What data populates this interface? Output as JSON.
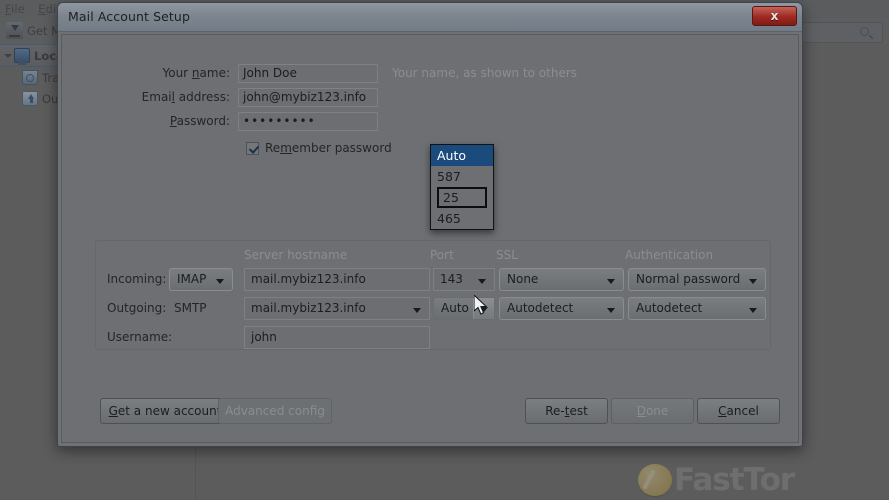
{
  "background": {
    "menubar": [
      {
        "pre": "",
        "accel": "F",
        "post": "ile"
      },
      {
        "pre": "",
        "accel": "E",
        "post": "dit"
      }
    ],
    "toolbar": {
      "get_mail_label": "Get M",
      "get_mail_icon": "download-icon"
    },
    "search": {
      "value": "",
      "icon": "search-icon"
    },
    "folders": [
      {
        "label": "Loca",
        "icon": "monitor-icon",
        "level": 1,
        "account": true
      },
      {
        "label": "Tra",
        "icon": "trash-icon",
        "level": 2,
        "account": false
      },
      {
        "label": "Ou",
        "icon": "outbox-icon",
        "level": 2,
        "account": false
      }
    ]
  },
  "watermark": {
    "text": "FastTor",
    "logo": "coin-logo"
  },
  "dialog": {
    "title": "Mail Account Setup",
    "close_label": "x",
    "account": {
      "name_label_pre": "Your ",
      "name_label_accel": "n",
      "name_label_post": "ame:",
      "name_value": "John Doe",
      "name_hint": "Your name, as shown to others",
      "email_label_pre": "Emai",
      "email_label_accel": "l",
      "email_label_post": " address:",
      "email_value": "john@mybiz123.info",
      "password_label_pre": "",
      "password_label_accel": "P",
      "password_label_post": "assword:",
      "password_value": "•••••••••",
      "remember_label_pre": "Re",
      "remember_label_accel": "m",
      "remember_label_post": "ember password",
      "remember_checked": true
    },
    "server": {
      "headers": {
        "hostname": "Server hostname",
        "port": "Port",
        "ssl": "SSL",
        "auth": "Authentication"
      },
      "incoming": {
        "row_label": "Incoming:",
        "protocol": "IMAP",
        "hostname": "mail.mybiz123.info",
        "port": "143",
        "ssl": "None",
        "auth": "Normal password"
      },
      "outgoing": {
        "row_label": "Outgoing:",
        "protocol": "SMTP",
        "hostname": "mail.mybiz123.info",
        "port": "Auto",
        "ssl": "Autodetect",
        "auth": "Autodetect"
      },
      "username": {
        "row_label": "Username:",
        "value": "john"
      }
    },
    "port_dropdown": {
      "open": true,
      "items": [
        {
          "label": "Auto",
          "selected": true,
          "focused": false
        },
        {
          "label": "587",
          "selected": false,
          "focused": false
        },
        {
          "label": "25",
          "selected": false,
          "focused": true
        },
        {
          "label": "465",
          "selected": false,
          "focused": false
        }
      ],
      "highlight_color": "#1b4a7d"
    },
    "buttons": {
      "get_new_account_pre": "",
      "get_new_account_accel": "G",
      "get_new_account_post": "et a new account",
      "advanced_config": "Advanced config",
      "advanced_config_disabled": true,
      "retest_pre": "Re-",
      "retest_accel": "t",
      "retest_post": "est",
      "done_pre": "",
      "done_accel": "D",
      "done_post": "one",
      "done_disabled": true,
      "cancel_pre": "",
      "cancel_accel": "C",
      "cancel_post": "ancel"
    }
  },
  "colors": {
    "dialog_bg": "#6d6f72",
    "title_bar": "#828b94",
    "close_red": "#9d2a22",
    "dropdown_highlight": "#1b4a7d",
    "hint_text": "#8b8e91"
  }
}
